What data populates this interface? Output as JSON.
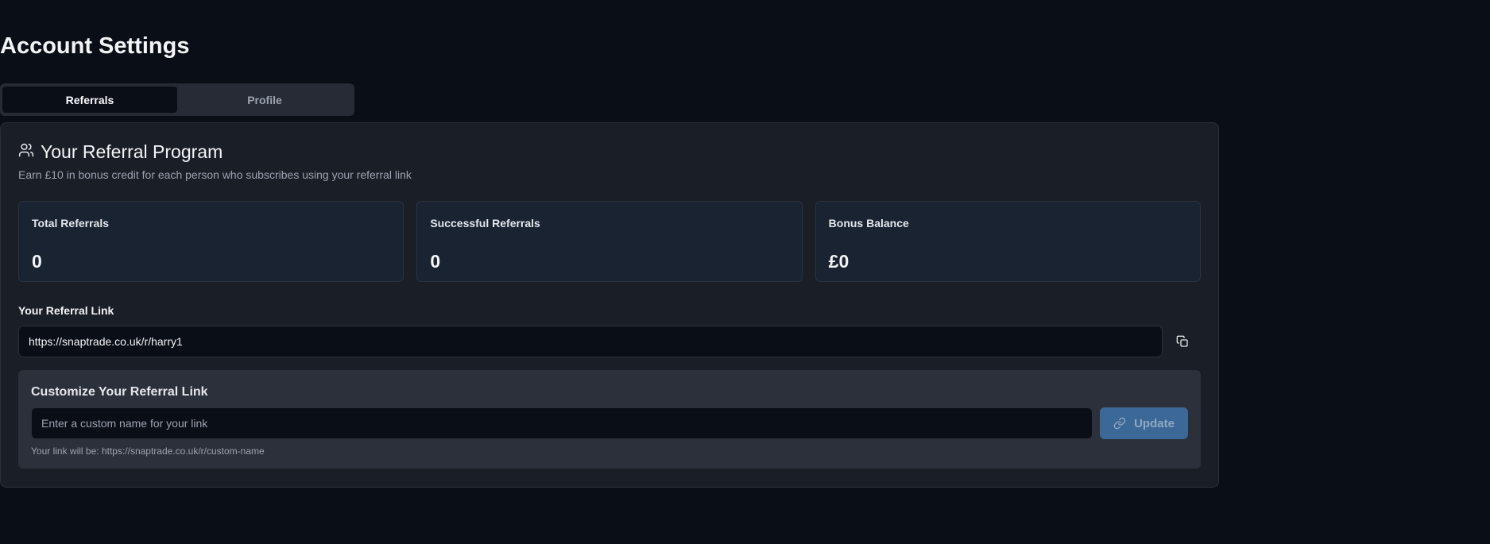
{
  "page": {
    "title": "Account Settings"
  },
  "tabs": [
    {
      "label": "Referrals",
      "active": true
    },
    {
      "label": "Profile",
      "active": false
    }
  ],
  "referral": {
    "icon": "users-icon",
    "title": "Your Referral Program",
    "subtitle": "Earn £10 in bonus credit for each person who subscribes using your referral link",
    "stats": [
      {
        "label": "Total Referrals",
        "value": "0"
      },
      {
        "label": "Successful Referrals",
        "value": "0"
      },
      {
        "label": "Bonus Balance",
        "value": "£0"
      }
    ],
    "link": {
      "label": "Your Referral Link",
      "value": "https://snaptrade.co.uk/r/harry1",
      "copy_icon": "copy-icon"
    },
    "customize": {
      "title": "Customize Your Referral Link",
      "placeholder": "Enter a custom name for your link",
      "button_label": "Update",
      "button_icon": "link-icon",
      "hint": "Your link will be: https://snaptrade.co.uk/r/custom-name"
    }
  },
  "colors": {
    "background": "#0a0e17",
    "card": "#1a1e27",
    "accent_button": "#3c6898"
  }
}
